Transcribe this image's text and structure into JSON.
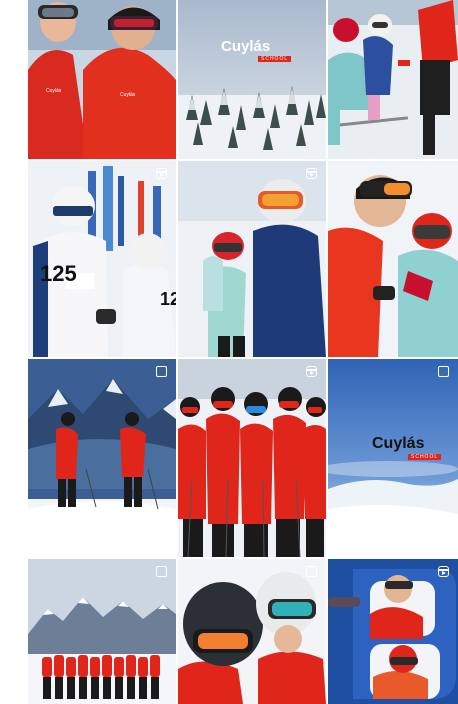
{
  "feed": {
    "logo_text": "Cuylás",
    "logo_subtext": "SCHOOL",
    "bib_numbers": [
      "125",
      "12"
    ],
    "tiles": [
      {
        "id": 1,
        "scene": "two instructors in red jackets with goggles"
      },
      {
        "id": 2,
        "scene": "snowy forest with logo"
      },
      {
        "id": 3,
        "scene": "kids skiing lesson"
      },
      {
        "id": 4,
        "scene": "racers with bibs"
      },
      {
        "id": 5,
        "scene": "children with helmets and goggles"
      },
      {
        "id": 6,
        "scene": "instructor with child selfie"
      },
      {
        "id": 7,
        "scene": "two instructors on mountain slope"
      },
      {
        "id": 8,
        "scene": "group of instructors in red"
      },
      {
        "id": 9,
        "scene": "logo over blue sky and snow"
      },
      {
        "id": 10,
        "scene": "team lineup in front of mountains"
      },
      {
        "id": 11,
        "scene": "instructors with helmets close-up"
      },
      {
        "id": 12,
        "scene": "instructors in letter frame"
      }
    ],
    "colors": {
      "brand_red": "#e0261b",
      "sky_blue": "#4a7bc2",
      "snow": "#f2f4f7"
    }
  }
}
